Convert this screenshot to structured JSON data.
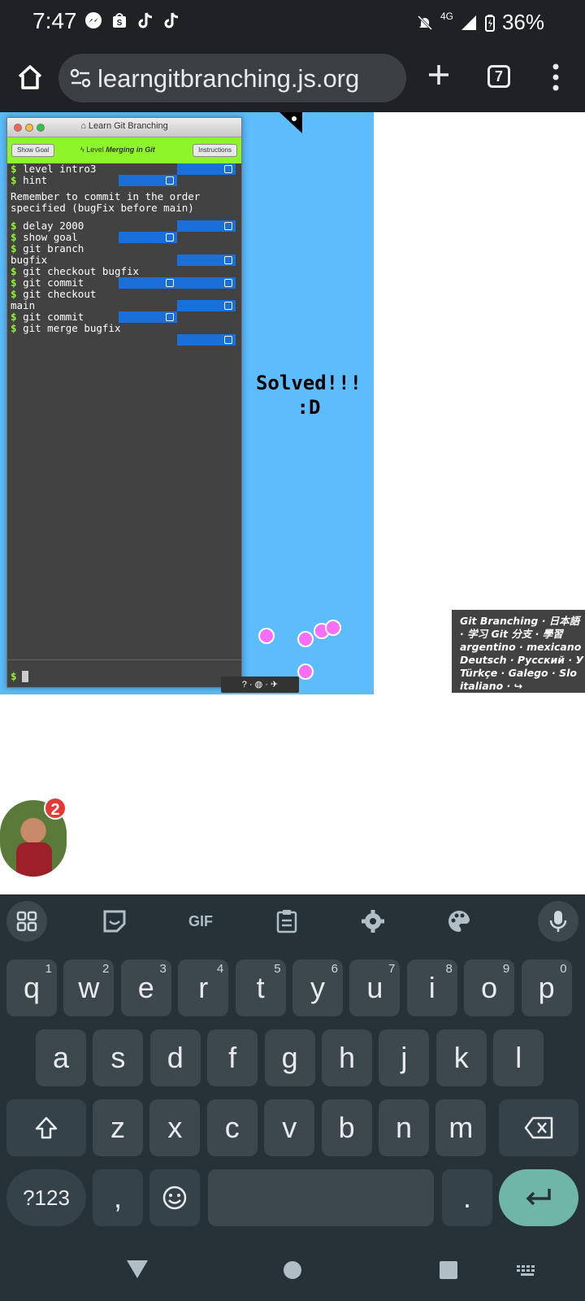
{
  "status_bar": {
    "time": "7:47",
    "network": "4G",
    "battery": "36%",
    "notification_icons": [
      "messenger-icon",
      "shop-icon",
      "tiktok-icon",
      "tiktok-icon"
    ]
  },
  "browser": {
    "url": "learngitbranching.js.org",
    "tab_count": "7"
  },
  "terminal": {
    "window_title": "Learn Git Branching",
    "show_goal_label": "Show Goal",
    "instructions_label": "Instructions",
    "level_prefix": "Level",
    "level_name": "Merging in Git",
    "prompt": "$",
    "hint_text": "Remember to commit in the order specified (bugFix before main)",
    "commands": [
      {
        "text": "level intro3"
      },
      {
        "text": "hint"
      },
      {
        "text": "delay 2000"
      },
      {
        "text": "show goal"
      },
      {
        "text": "git branch"
      },
      {
        "text": "bugfix",
        "continuation": true
      },
      {
        "text": "git checkout bugfix"
      },
      {
        "text": "git commit"
      },
      {
        "text": "git checkout"
      },
      {
        "text": "main",
        "continuation": true
      },
      {
        "text": "git commit"
      },
      {
        "text": "git merge bugfix"
      }
    ]
  },
  "visualization": {
    "solved_line1": "Solved!!!",
    "solved_line2": ":D",
    "help_bar": "? · ◍ · ✈"
  },
  "languages": {
    "line1": "Git Branching · 日本語",
    "line2": "· 学习 Git 分支 · 學習",
    "line3": "argentino · mexicano",
    "line4": "Deutsch · Русский · У",
    "line5": "Türkçe · Galego · Slo",
    "line6": "italiano · ↪"
  },
  "chat_head": {
    "badge_count": "2"
  },
  "keyboard": {
    "toolbar": [
      "apps-icon",
      "sticker-icon",
      "GIF",
      "clipboard-icon",
      "settings-icon",
      "palette-icon",
      "mic-icon"
    ],
    "row1": [
      {
        "k": "q",
        "n": "1"
      },
      {
        "k": "w",
        "n": "2"
      },
      {
        "k": "e",
        "n": "3"
      },
      {
        "k": "r",
        "n": "4"
      },
      {
        "k": "t",
        "n": "5"
      },
      {
        "k": "y",
        "n": "6"
      },
      {
        "k": "u",
        "n": "7"
      },
      {
        "k": "i",
        "n": "8"
      },
      {
        "k": "o",
        "n": "9"
      },
      {
        "k": "p",
        "n": "0"
      }
    ],
    "row2": [
      "a",
      "s",
      "d",
      "f",
      "g",
      "h",
      "j",
      "k",
      "l"
    ],
    "row3": [
      "z",
      "x",
      "c",
      "v",
      "b",
      "n",
      "m"
    ],
    "symbols_label": "?123",
    "comma": ",",
    "period": "."
  },
  "colors": {
    "page_blue": "#5cbcfc",
    "terminal_bg": "#424242",
    "level_bar": "#8ff52b",
    "check_blue": "#1a6fd8",
    "node_pink": "#f76ef7",
    "enter_key": "#6fb6a8"
  }
}
